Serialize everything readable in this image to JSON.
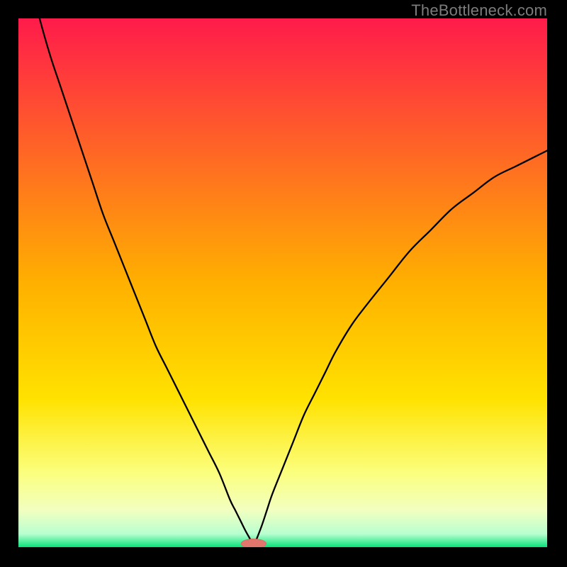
{
  "watermark": "TheBottleneck.com",
  "colors": {
    "background": "#000000",
    "gradient_top": "#ff1b4b",
    "gradient_mid": "#ffdf00",
    "gradient_low": "#fbff7e",
    "gradient_bottom": "#07e27a",
    "curve": "#000000",
    "marker_fill": "#e1766d",
    "marker_stroke": "#d65a54"
  },
  "chart_data": {
    "type": "line",
    "title": "",
    "xlabel": "",
    "ylabel": "",
    "xlim": [
      0,
      100
    ],
    "ylim": [
      0,
      100
    ],
    "notch_x": 44.5,
    "marker": {
      "x": 44.5,
      "y": 0,
      "rx": 2.4,
      "ry": 0.9
    },
    "series": [
      {
        "name": "bottleneck-curve",
        "x": [
          0,
          2,
          4,
          6,
          8,
          10,
          12,
          14,
          16,
          18,
          20,
          22,
          24,
          26,
          28,
          30,
          32,
          34,
          36,
          38,
          40,
          41,
          42,
          43,
          44,
          44.5,
          45,
          46,
          47,
          48,
          50,
          52,
          54,
          56,
          58,
          60,
          63,
          66,
          70,
          74,
          78,
          82,
          86,
          90,
          94,
          98,
          100
        ],
        "y": [
          116,
          108,
          100,
          93,
          87,
          81,
          75,
          69,
          63,
          58,
          53,
          48,
          43,
          38,
          34,
          30,
          26,
          22,
          18,
          14,
          9,
          7,
          5,
          3,
          1.2,
          0,
          1.4,
          4,
          7,
          10,
          15,
          20,
          25,
          29,
          33,
          37,
          42,
          46,
          51,
          56,
          60,
          64,
          67,
          70,
          72,
          74,
          75
        ]
      }
    ]
  }
}
